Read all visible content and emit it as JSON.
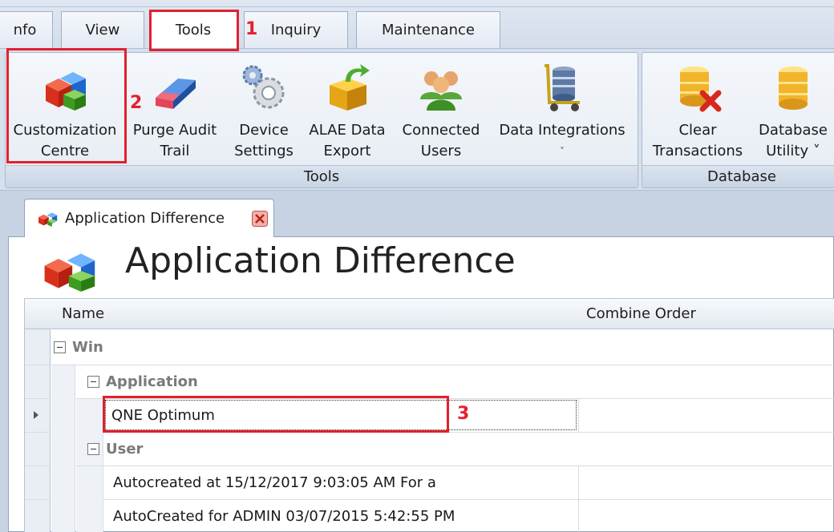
{
  "menu_tabs": [
    {
      "label": "nfo"
    },
    {
      "label": "View"
    },
    {
      "label": "Tools",
      "active": true
    },
    {
      "label": "Inquiry"
    },
    {
      "label": "Maintenance"
    }
  ],
  "ribbon": {
    "tools_group": {
      "label": "Tools",
      "buttons": [
        {
          "label_line1": "Customization",
          "label_line2": "Centre",
          "icon": "colored-blocks-icon"
        },
        {
          "label_line1": "Purge Audit",
          "label_line2": "Trail",
          "icon": "eraser-icon"
        },
        {
          "label_line1": "Device",
          "label_line2": "Settings",
          "icon": "gears-icon"
        },
        {
          "label_line1": "ALAE Data",
          "label_line2": "Export",
          "icon": "box-export-icon"
        },
        {
          "label_line1": "Connected",
          "label_line2": "Users",
          "icon": "users-icon"
        },
        {
          "label_line1": "Data Integrations",
          "label_line2": "˅",
          "icon": "database-cart-icon"
        }
      ]
    },
    "database_group": {
      "label": "Database",
      "buttons": [
        {
          "label_line1": "Clear",
          "label_line2": "Transactions",
          "icon": "database-delete-icon"
        },
        {
          "label_line1": "Database",
          "label_line2": "Utility ˅",
          "icon": "database-icon"
        }
      ]
    }
  },
  "document": {
    "tab_label": "Application Difference",
    "title": "Application Difference"
  },
  "grid": {
    "columns": [
      {
        "label": "Name",
        "sorted": "ascending"
      },
      {
        "label": "Combine Order"
      }
    ],
    "groups": {
      "win": "Win",
      "application": "Application",
      "user": "User"
    },
    "rows": {
      "app_row": "QNE Optimum",
      "user_row_1": "Autocreated at 15/12/2017 9:03:05 AM For a",
      "user_row_2": "AutoCreated for ADMIN 03/07/2015 5:42:55 PM"
    }
  },
  "annotations": [
    "1",
    "2",
    "3"
  ],
  "colors": {
    "annotation_red": "#e3202e",
    "ribbon_bg": "#d6e0ec"
  }
}
